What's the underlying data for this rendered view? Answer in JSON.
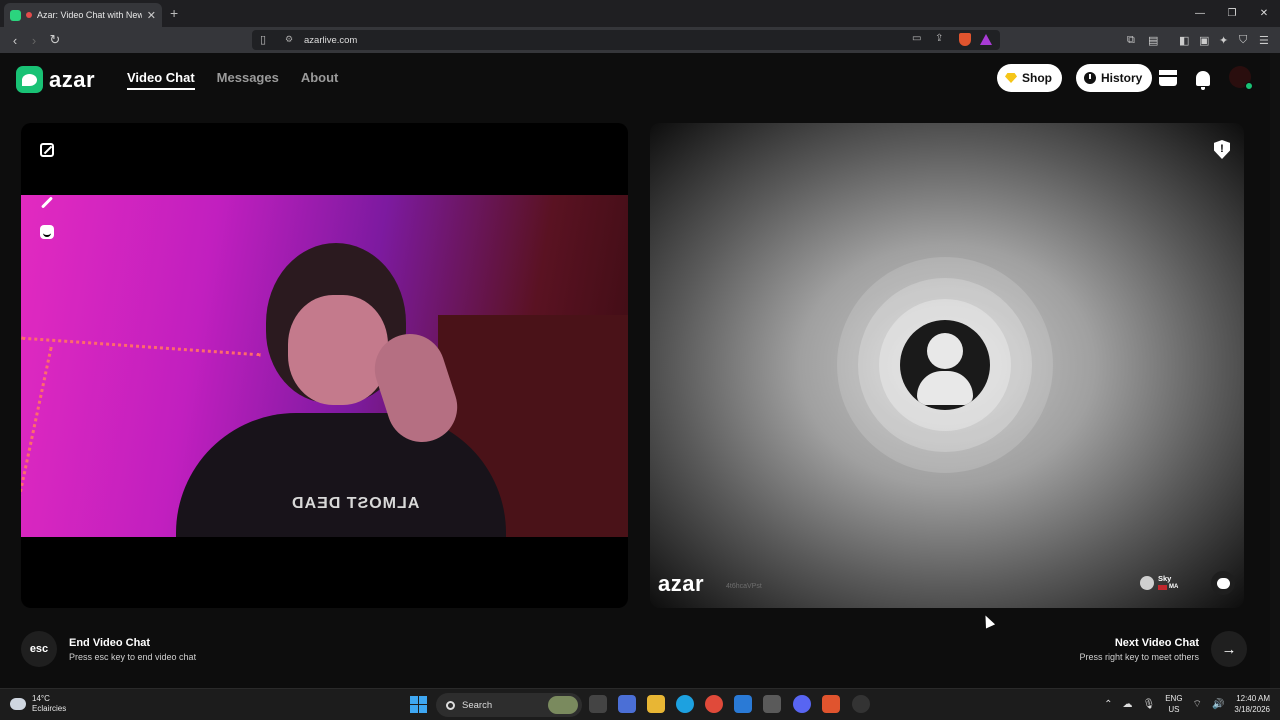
{
  "browser": {
    "tab_title": "Azar: Video Chat with New Pe",
    "new_tab": "+",
    "url": "azarlive.com",
    "window_controls": [
      "—",
      "❐",
      "✕"
    ]
  },
  "header": {
    "logo_text": "azar",
    "nav": [
      {
        "label": "Video Chat",
        "active": true
      },
      {
        "label": "Messages",
        "active": false
      },
      {
        "label": "About",
        "active": false
      }
    ],
    "shop_label": "Shop",
    "history_label": "History"
  },
  "remote": {
    "watermark": "azar",
    "session_id": "4t6hcaVPst",
    "user_name": "Sky",
    "user_country": "MA",
    "report_symbol": "!"
  },
  "local": {
    "shirt_text": "ALMOST DEAD"
  },
  "controls": {
    "end_key": "esc",
    "end_title": "End Video Chat",
    "end_hint": "Press esc key to end video chat",
    "next_title": "Next Video Chat",
    "next_hint": "Press right key to meet others",
    "next_arrow": "→"
  },
  "taskbar": {
    "temperature": "14°C",
    "weather": "Eclaircies",
    "search_placeholder": "Search",
    "language": "ENG",
    "region": "US",
    "time": "12:40 AM",
    "date": "3/18/2026"
  },
  "colors": {
    "brand_green": "#19c275",
    "shop_gem": "#f5c518",
    "windows_blue": "#3ea7f2"
  }
}
